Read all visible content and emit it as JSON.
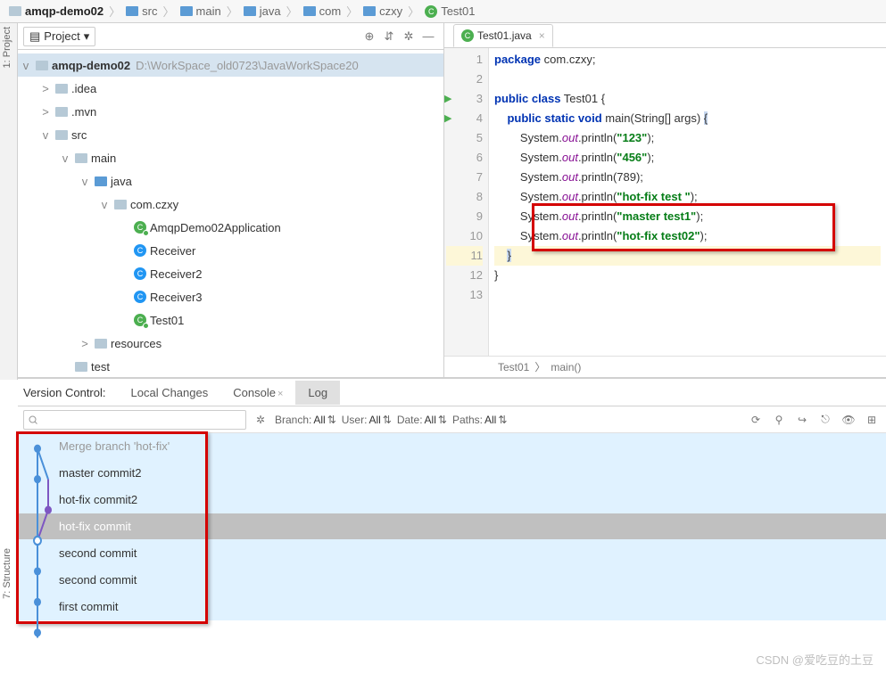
{
  "breadcrumb": [
    {
      "label": "amqp-demo02",
      "icon": "folder",
      "bold": true
    },
    {
      "label": "src",
      "icon": "folder-blue"
    },
    {
      "label": "main",
      "icon": "folder-blue"
    },
    {
      "label": "java",
      "icon": "folder-blue"
    },
    {
      "label": "com",
      "icon": "folder-blue"
    },
    {
      "label": "czxy",
      "icon": "folder-blue"
    },
    {
      "label": "Test01",
      "icon": "class"
    }
  ],
  "rails": {
    "project": "1: Project",
    "structure": "7: Structure"
  },
  "project_header": {
    "title": "Project"
  },
  "tree": {
    "root": {
      "label": "amqp-demo02",
      "path": "D:\\WorkSpace_old0723\\JavaWorkSpace20"
    },
    "items": [
      {
        "indent": 1,
        "arrow": ">",
        "icon": "folder",
        "label": ".idea"
      },
      {
        "indent": 1,
        "arrow": ">",
        "icon": "folder",
        "label": ".mvn"
      },
      {
        "indent": 1,
        "arrow": "v",
        "icon": "folder",
        "label": "src"
      },
      {
        "indent": 2,
        "arrow": "v",
        "icon": "folder",
        "label": "main"
      },
      {
        "indent": 3,
        "arrow": "v",
        "icon": "folder-blue",
        "label": "java"
      },
      {
        "indent": 4,
        "arrow": "v",
        "icon": "folder",
        "label": "com.czxy"
      },
      {
        "indent": 5,
        "arrow": "",
        "icon": "class",
        "label": "AmqpDemo02Application"
      },
      {
        "indent": 5,
        "arrow": "",
        "icon": "class-c",
        "label": "Receiver"
      },
      {
        "indent": 5,
        "arrow": "",
        "icon": "class-c",
        "label": "Receiver2"
      },
      {
        "indent": 5,
        "arrow": "",
        "icon": "class-c",
        "label": "Receiver3"
      },
      {
        "indent": 5,
        "arrow": "",
        "icon": "class",
        "label": "Test01"
      },
      {
        "indent": 3,
        "arrow": ">",
        "icon": "folder",
        "label": "resources"
      },
      {
        "indent": 2,
        "arrow": "",
        "icon": "folder",
        "label": "test"
      }
    ]
  },
  "editor": {
    "tab": "Test01.java",
    "lines": [
      {
        "n": 1,
        "html": "<span class='kw'>package</span> com.czxy;"
      },
      {
        "n": 2,
        "html": ""
      },
      {
        "n": 3,
        "html": "<span class='kw'>public class</span> Test01 {",
        "run": true
      },
      {
        "n": 4,
        "html": "    <span class='kw'>public static void</span> main(String[] args) <span style='background:#c7d8f0'>{</span>",
        "run": true
      },
      {
        "n": 5,
        "html": "        System.<span class='fld'>out</span>.println(<span class='str'>\"123\"</span>);"
      },
      {
        "n": 6,
        "html": "        System.<span class='fld'>out</span>.println(<span class='str'>\"456\"</span>);"
      },
      {
        "n": 7,
        "html": "        System.<span class='fld'>out</span>.println(789);"
      },
      {
        "n": 8,
        "html": "        System.<span class='fld'>out</span>.println(<span class='str'>\"hot-fix test \"</span>);"
      },
      {
        "n": 9,
        "html": "        System.<span class='fld'>out</span>.println(<span class='str'>\"master test1\"</span>);"
      },
      {
        "n": 10,
        "html": "        System.<span class='fld'>out</span>.println(<span class='str'>\"hot-fix test02\"</span>);"
      },
      {
        "n": 11,
        "html": "    <span style='background:#c7d8f0'>}</span>",
        "cur": true
      },
      {
        "n": 12,
        "html": "}"
      },
      {
        "n": 13,
        "html": ""
      }
    ],
    "crumbs": [
      "Test01",
      "main()"
    ]
  },
  "vcs": {
    "title": "Version Control:",
    "tabs": [
      {
        "label": "Local Changes"
      },
      {
        "label": "Console",
        "close": true
      },
      {
        "label": "Log",
        "active": true
      }
    ],
    "filters": {
      "branch": {
        "label": "Branch:",
        "value": "All"
      },
      "user": {
        "label": "User:",
        "value": "All"
      },
      "date": {
        "label": "Date:",
        "value": "All"
      },
      "paths": {
        "label": "Paths:",
        "value": "All"
      }
    },
    "search_placeholder": "",
    "log": [
      {
        "label": "Merge branch 'hot-fix'",
        "first": true
      },
      {
        "label": "master commit2"
      },
      {
        "label": "hot-fix commit2"
      },
      {
        "label": "hot-fix commit",
        "sel": true
      },
      {
        "label": "second commit"
      },
      {
        "label": "second commit"
      },
      {
        "label": "first commit"
      }
    ]
  },
  "watermark": "CSDN @爱吃豆的土豆"
}
